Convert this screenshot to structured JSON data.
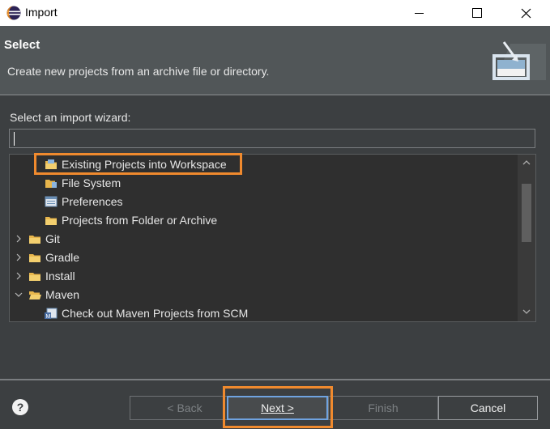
{
  "window": {
    "title": "Import",
    "icons": {
      "app": "eclipse-icon",
      "minimize": "minimize-icon",
      "maximize": "maximize-icon",
      "close": "close-icon"
    }
  },
  "header": {
    "title": "Select",
    "description": "Create new projects from an archive file or directory.",
    "banner_icon": "import-wizard-banner-icon"
  },
  "wizard": {
    "label": "Select an import wizard:",
    "filter_value": "",
    "items": [
      {
        "label": "Existing Projects into Workspace",
        "icon": "folder-project-icon",
        "level": 1,
        "expander": "none",
        "selected": true
      },
      {
        "label": "File System",
        "icon": "folder-file-icon",
        "level": 1,
        "expander": "none"
      },
      {
        "label": "Preferences",
        "icon": "preferences-icon",
        "level": 1,
        "expander": "none"
      },
      {
        "label": "Projects from Folder or Archive",
        "icon": "folder-archive-icon",
        "level": 1,
        "expander": "none"
      },
      {
        "label": "Git",
        "icon": "folder-icon",
        "level": 0,
        "expander": "collapsed"
      },
      {
        "label": "Gradle",
        "icon": "folder-icon",
        "level": 0,
        "expander": "collapsed"
      },
      {
        "label": "Install",
        "icon": "folder-icon",
        "level": 0,
        "expander": "collapsed"
      },
      {
        "label": "Maven",
        "icon": "folder-open-icon",
        "level": 0,
        "expander": "expanded"
      },
      {
        "label": "Check out Maven Projects from SCM",
        "icon": "maven-scm-icon",
        "level": 1,
        "expander": "none"
      }
    ]
  },
  "buttons": {
    "back": "< Back",
    "next": "Next >",
    "finish": "Finish",
    "cancel": "Cancel",
    "help_icon": "help-icon"
  },
  "colors": {
    "highlight": "#f08a2e",
    "background": "#3c3f41",
    "header": "#515658"
  }
}
